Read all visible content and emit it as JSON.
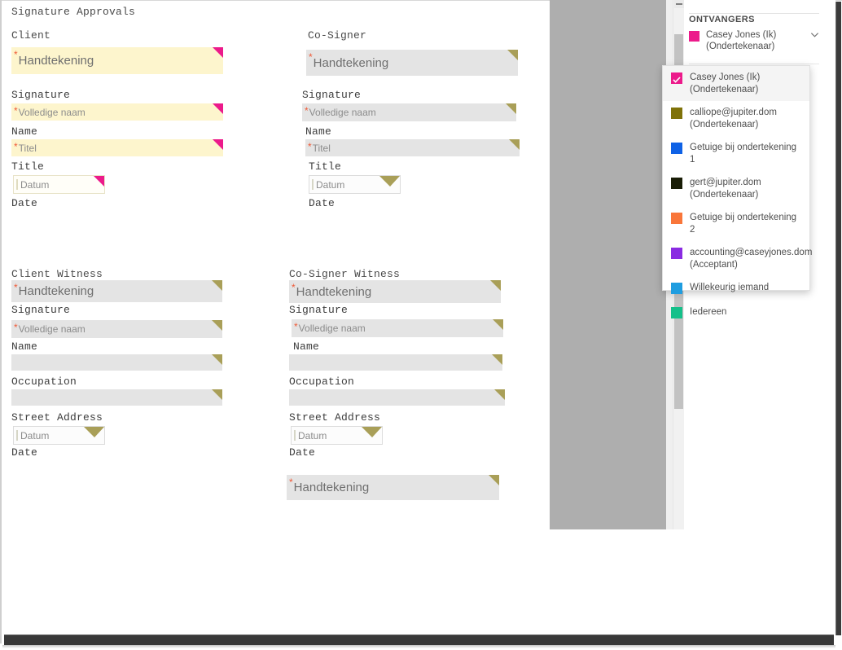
{
  "document": {
    "title": "Signature Approvals",
    "sections": [
      {
        "id": "client",
        "heading": "Client",
        "style": "yellow",
        "fields": [
          {
            "placeholder": "Handtekening",
            "label": "Signature",
            "required": true,
            "size": "big"
          },
          {
            "placeholder": "Volledige naam",
            "label": "Name",
            "required": true,
            "size": "small"
          },
          {
            "placeholder": "Titel",
            "label": "Title",
            "required": true,
            "size": "small"
          },
          {
            "placeholder": "Datum",
            "label": "Date",
            "required": false,
            "size": "date"
          }
        ]
      },
      {
        "id": "co-signer",
        "heading": "Co-Signer",
        "style": "gray",
        "fields": [
          {
            "placeholder": "Handtekening",
            "label": "Signature",
            "required": true,
            "size": "big"
          },
          {
            "placeholder": "Volledige naam",
            "label": "Name",
            "required": true,
            "size": "small"
          },
          {
            "placeholder": "Titel",
            "label": "Title",
            "required": true,
            "size": "small"
          },
          {
            "placeholder": "Datum",
            "label": "Date",
            "required": false,
            "size": "date"
          }
        ]
      },
      {
        "id": "client-witness",
        "heading": "Client Witness",
        "style": "gray",
        "fields": [
          {
            "placeholder": "Handtekening",
            "label": "Signature",
            "required": true,
            "size": "big"
          },
          {
            "placeholder": "Volledige naam",
            "label": "Name",
            "required": true,
            "size": "small"
          },
          {
            "placeholder": "",
            "label": "Occupation",
            "required": false,
            "size": "small"
          },
          {
            "placeholder": "",
            "label": "Street Address",
            "required": false,
            "size": "small"
          },
          {
            "placeholder": "Datum",
            "label": "Date",
            "required": false,
            "size": "date"
          }
        ]
      },
      {
        "id": "co-signer-witness",
        "heading": "Co-Signer Witness",
        "style": "gray",
        "fields": [
          {
            "placeholder": "Handtekening",
            "label": "Signature",
            "required": true,
            "size": "big"
          },
          {
            "placeholder": "Volledige naam",
            "label": "Name",
            "required": true,
            "size": "small"
          },
          {
            "placeholder": "",
            "label": "Occupation",
            "required": false,
            "size": "small"
          },
          {
            "placeholder": "",
            "label": "Street Address",
            "required": false,
            "size": "small"
          },
          {
            "placeholder": "Datum",
            "label": "Date",
            "required": false,
            "size": "date"
          }
        ]
      }
    ],
    "extra_signature": {
      "placeholder": "Handtekening",
      "required": true
    }
  },
  "recipients_panel": {
    "header": "ONTVANGERS",
    "selected": {
      "name": "Casey Jones (Ik)",
      "role": "(Ondertekenaar)",
      "color": "#ec1a8b"
    },
    "chevron_icon": "chevron-down-icon"
  },
  "dropdown": {
    "items": [
      {
        "name": "Casey Jones (Ik)",
        "role": "(Ondertekenaar)",
        "color": "#ec1a8b",
        "selected": true
      },
      {
        "name": "calliope@jupiter.dom",
        "role": "(Ondertekenaar)",
        "color": "#7f7209",
        "selected": false
      },
      {
        "name": "Getuige bij ondertekening 1",
        "role": "",
        "color": "#0f62e6",
        "selected": false
      },
      {
        "name": "gert@jupiter.dom",
        "role": "(Ondertekenaar)",
        "color": "#191d06",
        "selected": false
      },
      {
        "name": "Getuige bij ondertekening 2",
        "role": "",
        "color": "#f9763a",
        "selected": false
      },
      {
        "name": "accounting@caseyjones.dom",
        "role": "(Acceptant)",
        "color": "#8a2be2",
        "selected": false
      },
      {
        "name": "Willekeurig iemand",
        "role": "",
        "color": "#1f9de0",
        "selected": false
      },
      {
        "name": "Iedereen",
        "role": "",
        "color": "#14c08a",
        "selected": false
      }
    ]
  },
  "colors": {
    "accent_pink": "#ec1a8b",
    "field_yellow": "#fdf5cd",
    "field_gray": "#e4e4e4",
    "corner_olive": "#a99f58",
    "required_star": "#ef5a38"
  }
}
